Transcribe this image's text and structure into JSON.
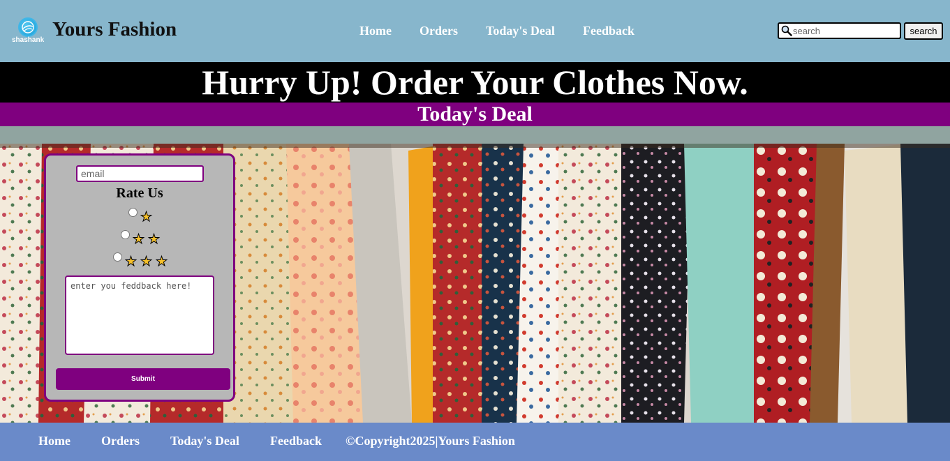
{
  "header": {
    "logo_text": "shashank",
    "brand": "Yours Fashion",
    "nav": [
      "Home",
      "Orders",
      "Today's Deal",
      "Feedback"
    ],
    "search_placeholder": "search",
    "search_button": "search"
  },
  "banner": {
    "headline": "Hurry Up! Order Your Clothes Now.",
    "subheadline": "Today's Deal"
  },
  "form": {
    "email_placeholder": "email",
    "rating_title": "Rate Us",
    "rating_options": [
      1,
      2,
      3
    ],
    "feedback_placeholder": "enter you feddback here!",
    "submit_label": "Submit"
  },
  "footer": {
    "nav": [
      "Home",
      "Orders",
      "Today's Deal",
      "Feedback"
    ],
    "copyright": "©Copyright2025|Yours Fashion"
  },
  "colors": {
    "header_bg": "#87b6cc",
    "headline_bg": "#000000",
    "deal_bg": "#7f007f",
    "accent": "#7f007f",
    "footer_bg": "#6a8ac9",
    "star": "#f7c12a"
  },
  "icons": {
    "logo": "globe-icon",
    "search": "magnifier-icon",
    "rating": "star-icon"
  }
}
